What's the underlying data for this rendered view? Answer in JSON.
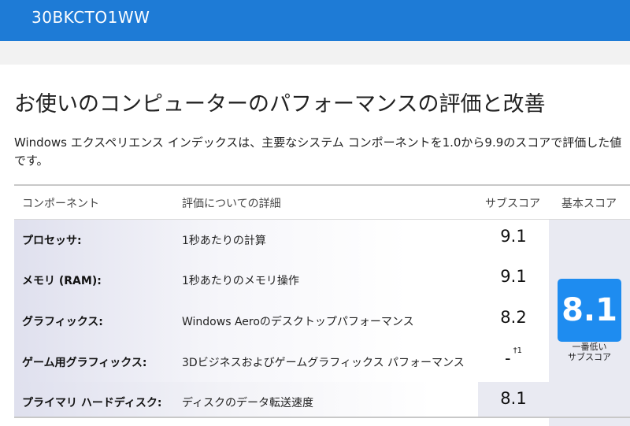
{
  "header": {
    "machine_name": "30BKCTO1WW"
  },
  "page": {
    "title": "お使いのコンピューターのパフォーマンスの評価と改善",
    "description": "Windows エクスペリエンス インデックスは、主要なシステム コンポーネントを1.0から9.9のスコアで評価した値です。"
  },
  "table": {
    "headers": {
      "component": "コンポーネント",
      "detail": "評価についての詳細",
      "subscore": "サブスコア",
      "base": "基本スコア"
    },
    "rows": [
      {
        "component": "プロセッサ:",
        "detail": "1秒あたりの計算",
        "subscore": "9.1",
        "note": ""
      },
      {
        "component": "メモリ (RAM):",
        "detail": "1秒あたりのメモリ操作",
        "subscore": "9.1",
        "note": ""
      },
      {
        "component": "グラフィックス:",
        "detail": "Windows Aeroのデスクトップパフォーマンス",
        "subscore": "8.2",
        "note": ""
      },
      {
        "component": "ゲーム用グラフィックス:",
        "detail": "3Dビジネスおよびゲームグラフィックス パフォーマンス",
        "subscore": "-",
        "note": "†1"
      },
      {
        "component": "プライマリ ハードディスク:",
        "detail": "ディスクのデータ転送速度",
        "subscore": "8.1",
        "note": ""
      }
    ],
    "base_score": "8.1",
    "base_caption_line1": "一番低い",
    "base_caption_line2": "サブスコア"
  },
  "colors": {
    "topbar": "#1e7bd6",
    "base_score_bg": "#1e8cf0"
  }
}
